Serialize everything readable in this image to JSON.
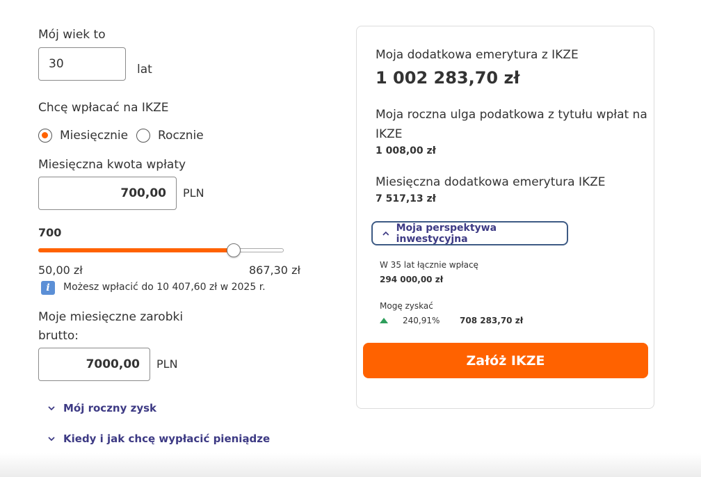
{
  "age": {
    "label": "Mój wiek to",
    "value": "30",
    "unit": "lat"
  },
  "frequency": {
    "label": "Chcę wpłacać na IKZE",
    "options": [
      "Miesięcznie",
      "Rocznie"
    ],
    "selected": "Miesięcznie"
  },
  "amount": {
    "label": "Miesięczna kwota wpłaty",
    "value": "700,00",
    "currency": "PLN"
  },
  "slider": {
    "value_label": "700",
    "value": 700,
    "min": 50,
    "max": 867.3,
    "min_label": "50,00 zł",
    "max_label": "867,30 zł",
    "accent": "#ff6200"
  },
  "info": {
    "icon": "info-icon",
    "text": "Możesz wpłacić do 10 407,60 zł w 2025 r."
  },
  "earnings": {
    "label_line1": "Moje miesięczne zarobki",
    "label_line2": "brutto:",
    "value": "7000,00",
    "currency": "PLN"
  },
  "links": {
    "annual_profit": "Mój roczny zysk",
    "withdraw": "Kiedy i jak chcę wypłacić pieniądze"
  },
  "summary": {
    "pension_label": "Moja dodatkowa emerytura z IKZE",
    "pension_value": "1 002 283,70 zł",
    "tax_relief_line1": "Moja roczna ulga podatkowa z tytułu wpłat na",
    "tax_relief_line2": "IKZE",
    "tax_relief_value": "1 008,00 zł",
    "monthly_label": "Miesięczna dodatkowa emerytura IKZE",
    "monthly_value": "7 517,13 zł",
    "perspective_label": "Moja perspektywa inwestycyjna",
    "total_paid_label": "W 35 lat łącznie wpłacę",
    "total_paid_value": "294 000,00 zł",
    "gain_label": "Mogę zyskać",
    "gain_percent": "240,91%",
    "gain_value": "708 283,70 zł",
    "gain_color": "#2e9e5b",
    "cta_label": "Załóż IKZE",
    "cta_color": "#ff6200"
  }
}
